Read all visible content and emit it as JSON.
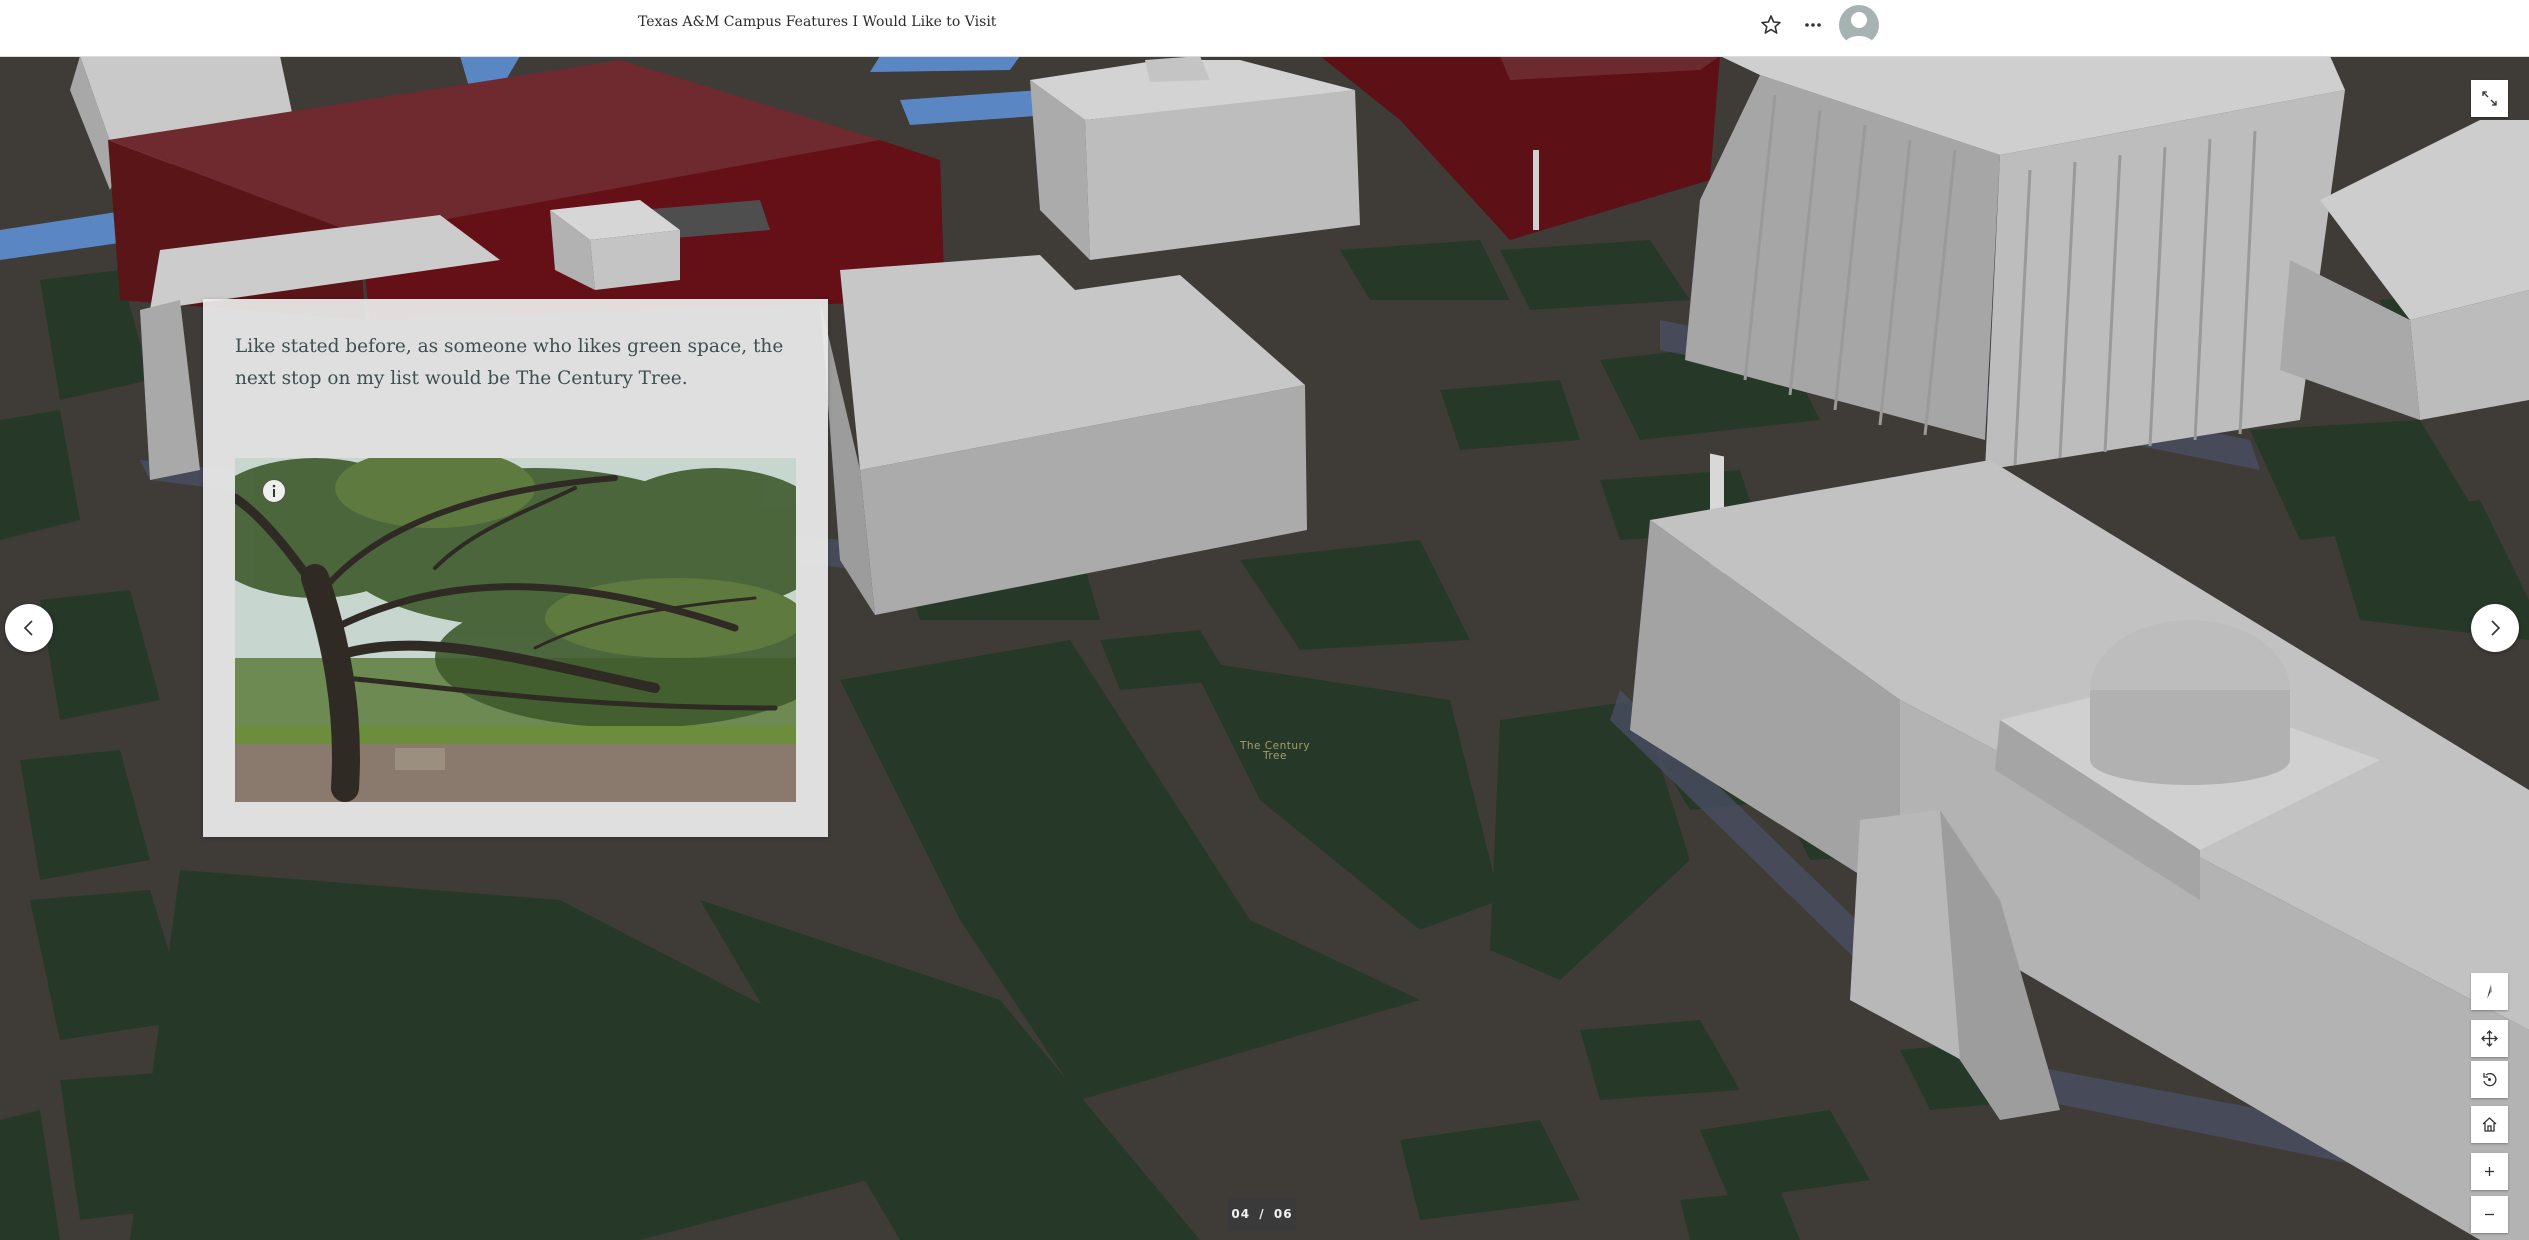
{
  "header": {
    "title": "Texas A&M Campus Features I Would Like to Visit"
  },
  "story": {
    "text": "Like stated before, as someone who likes green space, the next stop on my list would be The Century Tree."
  },
  "map": {
    "label": "The Century Tree"
  },
  "pager": {
    "current": "04",
    "separator": "/",
    "total": "06"
  },
  "icons": {
    "favorite": "star-icon",
    "more": "ellipsis-icon",
    "avatar": "user-avatar-icon",
    "fullscreen": "expand-icon",
    "compass": "compass-icon",
    "pan": "pan-icon",
    "rotate": "rotate-icon",
    "home": "home-icon",
    "zoom_in": "plus-icon",
    "zoom_out": "minus-icon",
    "previous": "chevron-left-icon",
    "next": "chevron-right-icon",
    "info": "info-icon"
  },
  "colors": {
    "ground": "#3f3c38",
    "grass": "#263828",
    "building": "#b7b7b7",
    "brick": "#5e1b1f",
    "water": "#5a86c4"
  }
}
